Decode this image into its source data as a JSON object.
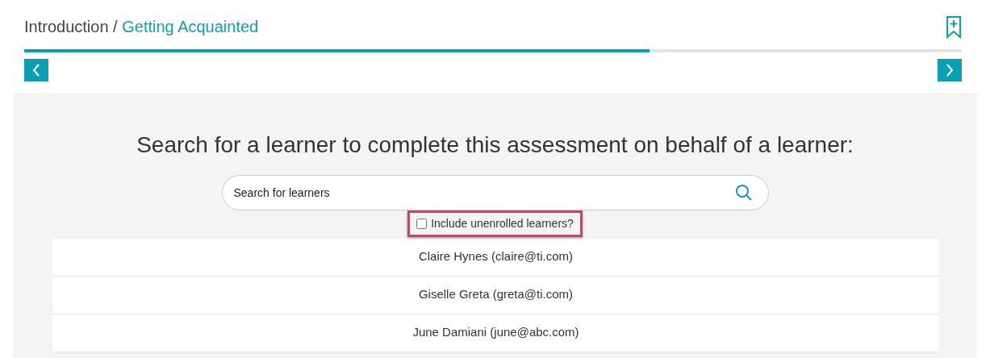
{
  "breadcrumb": {
    "parent": "Introduction",
    "separator": "/",
    "current": "Getting Acquainted"
  },
  "progress": {
    "level": 0.667
  },
  "heading": "Search for a learner to complete this assessment on behalf of a learner:",
  "search": {
    "placeholder": "Search for learners"
  },
  "include_unenrolled": {
    "label": "Include unenrolled learners?",
    "checked": false,
    "highlighted": true
  },
  "learners": [
    {
      "label": "Claire Hynes (claire@ti.com)"
    },
    {
      "label": "Giselle Greta (greta@ti.com)"
    },
    {
      "label": "June Damiani (june@abc.com)"
    }
  ]
}
